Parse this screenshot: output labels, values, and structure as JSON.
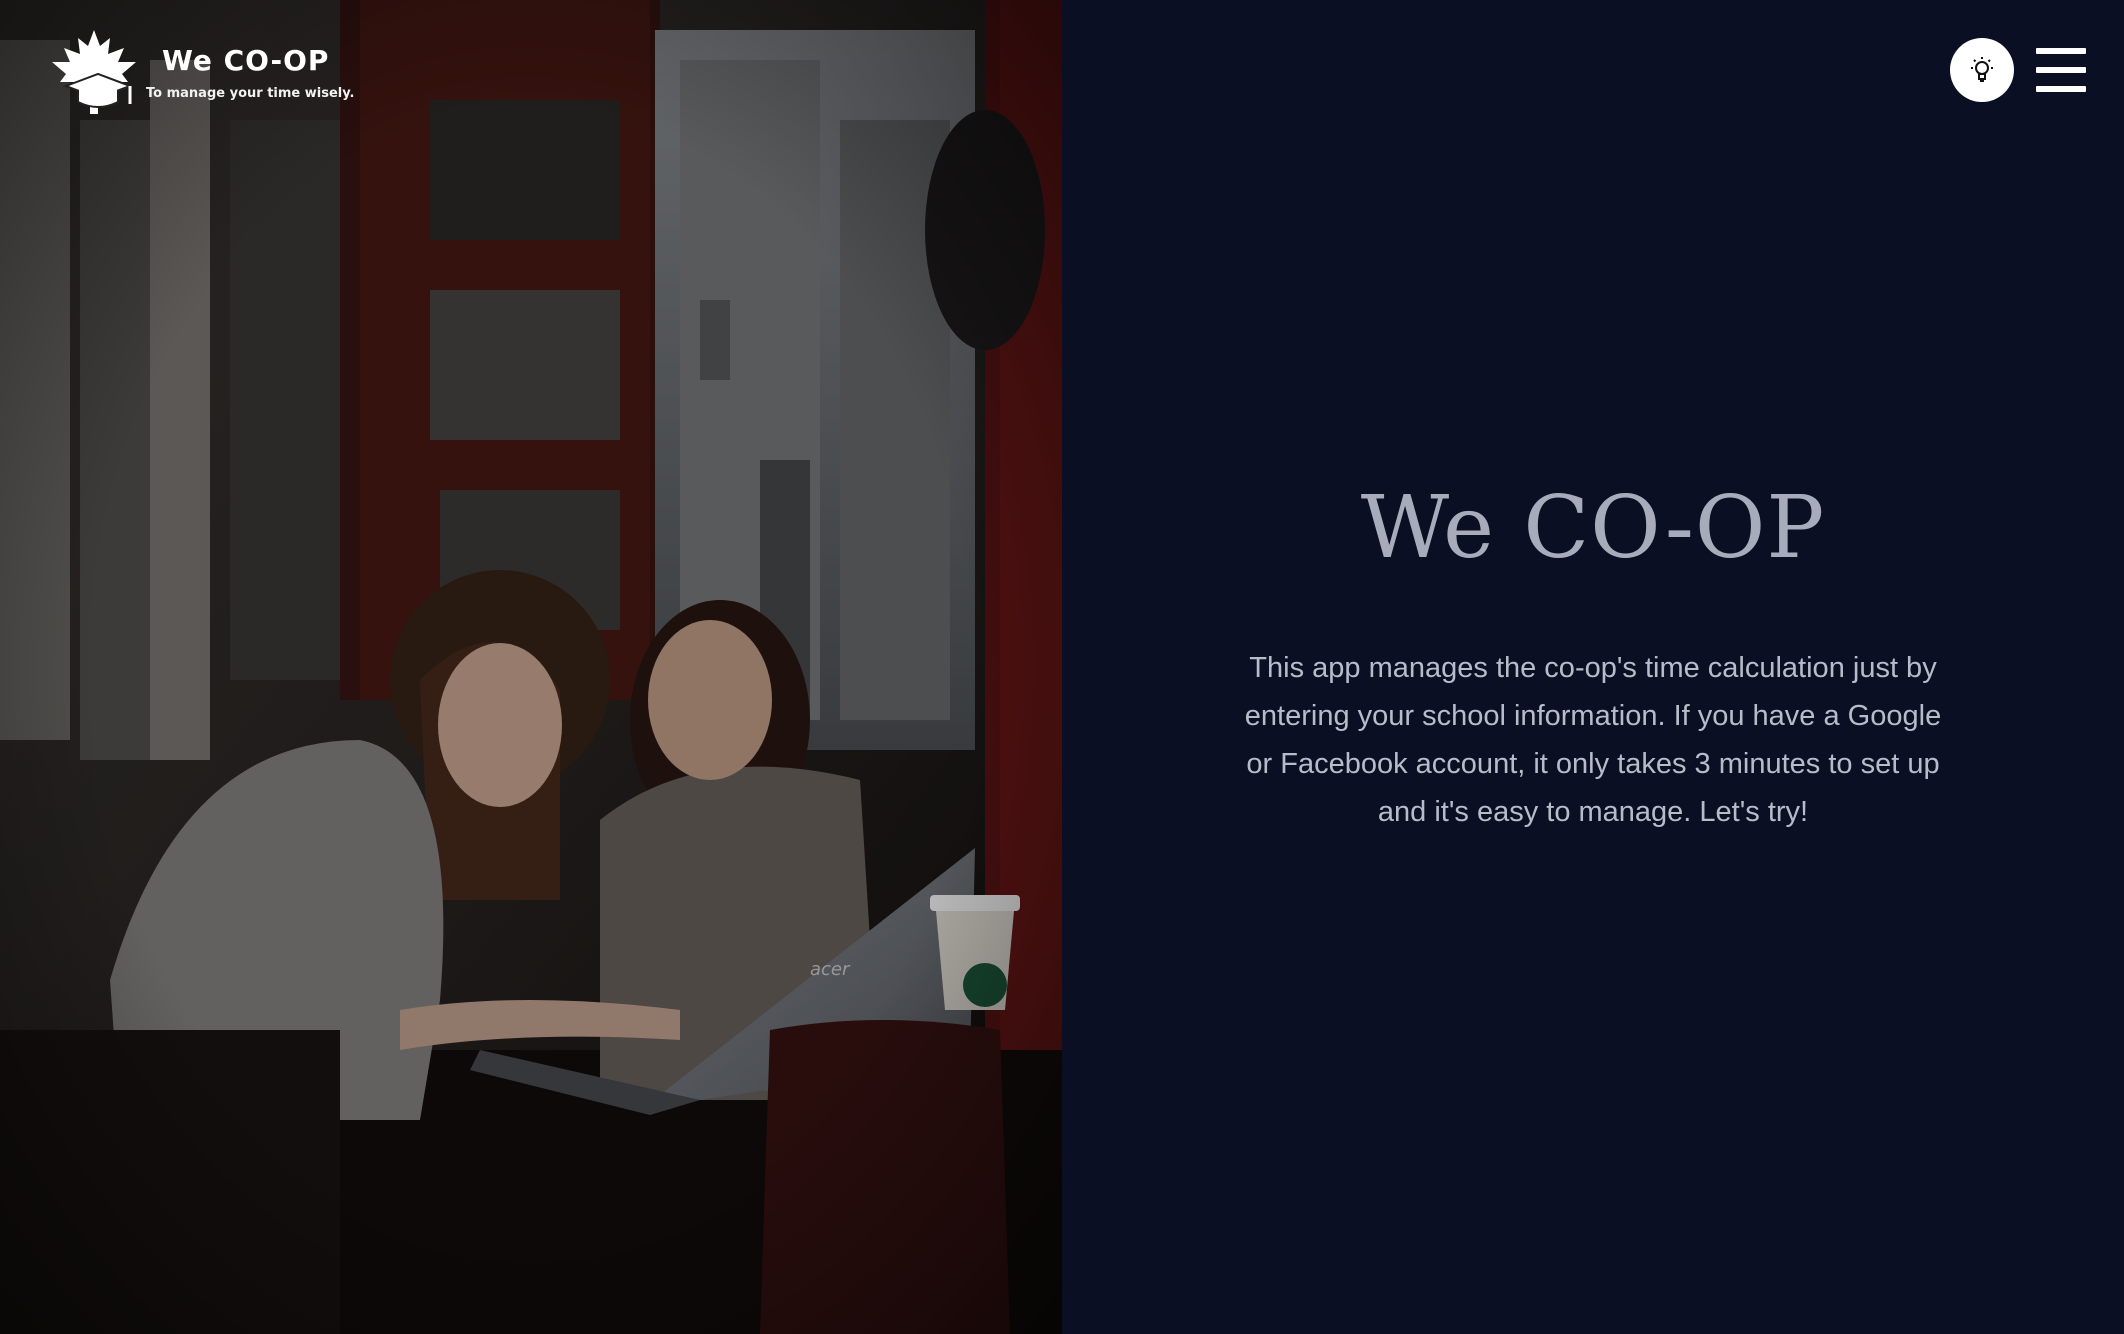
{
  "brand": {
    "name": "We CO-OP",
    "tagline": "To manage your time wisely."
  },
  "header": {
    "theme_toggle_icon": "lightbulb-icon",
    "menu_icon": "hamburger-menu-icon"
  },
  "hero": {
    "title": "We CO-OP",
    "description": "This app manages the co-op's time calculation just by entering your school information. If you have a Google or Facebook account, it only takes 3 minutes to set up and it's easy to manage. Let's try!",
    "photo_brand_text": "acer"
  },
  "colors": {
    "panel_background": "#0b0f24",
    "title_color": "#a8abb9",
    "text_color": "#b8bbc8",
    "accent_red": "#5e1414"
  }
}
